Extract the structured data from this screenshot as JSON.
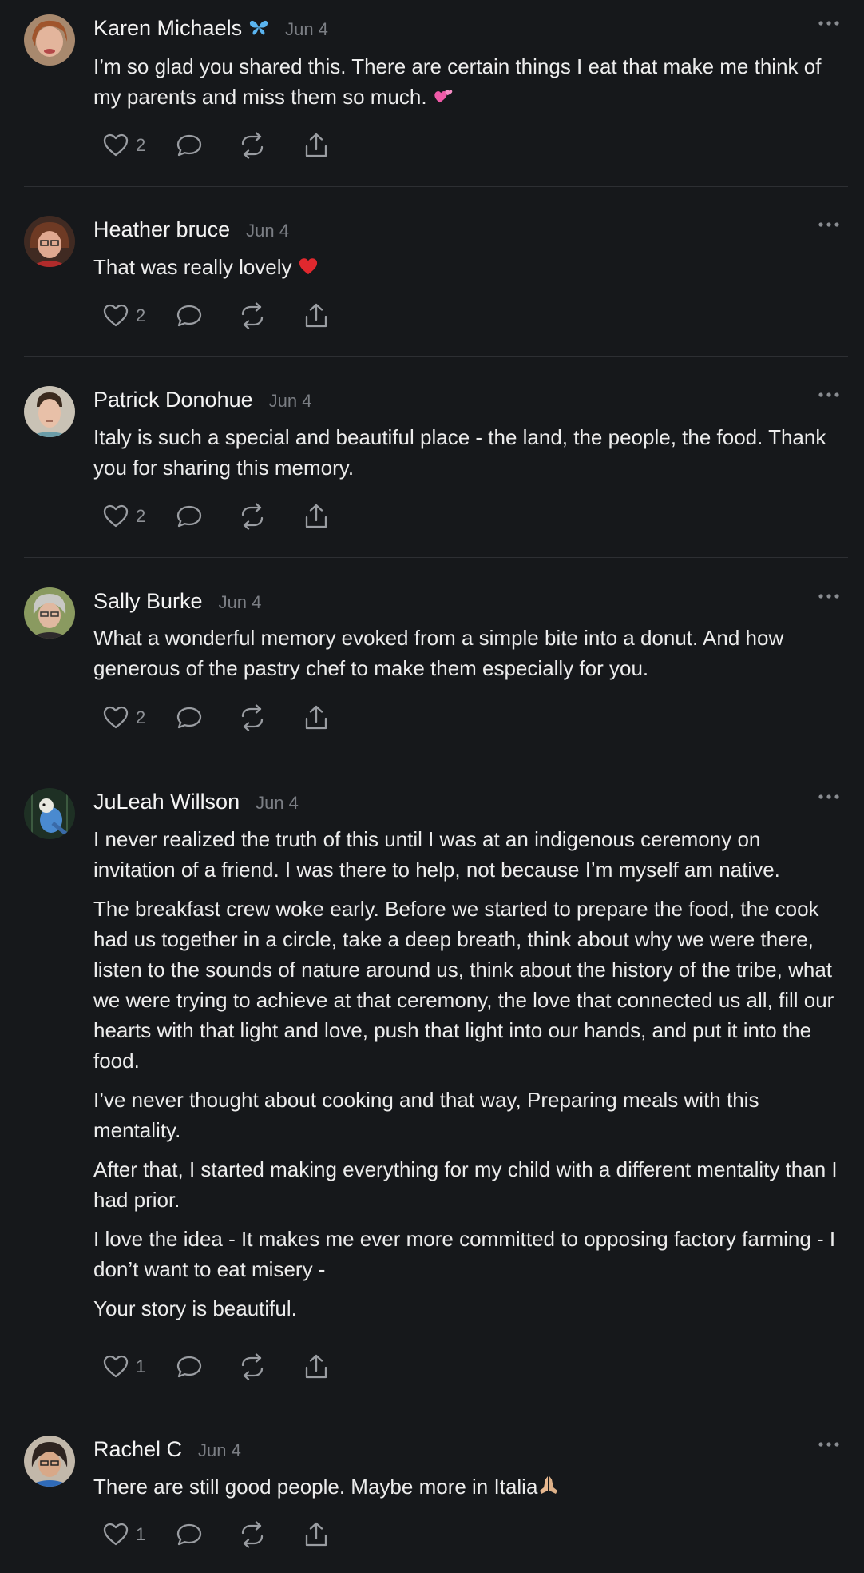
{
  "comments": [
    {
      "author": "Karen Michaels",
      "badge_icon": "butterfly-icon",
      "date": "Jun 4",
      "paragraphs": [
        "I’m so glad you shared this. There are certain things I eat that make me think of my parents and miss them so much."
      ],
      "emoji_icon": "two-hearts-icon",
      "likes": "2"
    },
    {
      "author": "Heather bruce",
      "date": "Jun 4",
      "paragraphs": [
        "That was really lovely"
      ],
      "emoji_icon": "red-heart-icon",
      "likes": "2"
    },
    {
      "author": "Patrick Donohue",
      "date": "Jun 4",
      "paragraphs": [
        "Italy is such a special and beautiful place - the land, the people, the food. Thank you for sharing this memory."
      ],
      "likes": "2"
    },
    {
      "author": "Sally Burke",
      "date": "Jun 4",
      "paragraphs": [
        "What a wonderful memory evoked from a simple bite into a donut. And how generous of the pastry chef to make them especially for you."
      ],
      "likes": "2"
    },
    {
      "author": "JuLeah Willson",
      "date": "Jun 4",
      "paragraphs": [
        "I never realized the truth of this until I was at an indigenous ceremony on invitation of a friend. I was there to help, not because I’m myself am native.",
        "The breakfast crew woke early. Before we started to prepare the food, the cook had us together in a circle, take a deep breath, think about why we were there, listen to the sounds of nature around us, think about the history of the tribe, what we were trying to achieve at that ceremony, the love that connected us all, fill our hearts with that light and love, push that light into our hands, and put it into the food.",
        "I’ve never thought about cooking and that way, Preparing meals with this mentality.",
        "After that, I started making everything for my child with a different mentality than I had prior.",
        "I love the idea - It makes me ever more committed to opposing factory farming - I don’t want to eat misery -",
        "Your story is beautiful."
      ],
      "likes": "1"
    },
    {
      "author": "Rachel C",
      "date": "Jun 4",
      "paragraphs": [
        "There are still good people. Maybe more in Italia"
      ],
      "emoji_icon": "folded-hands-icon",
      "likes": "1"
    }
  ],
  "colors": {
    "background": "#16181b",
    "text": "#ececec",
    "muted": "#7b7e84",
    "divider": "#2d2f33"
  }
}
